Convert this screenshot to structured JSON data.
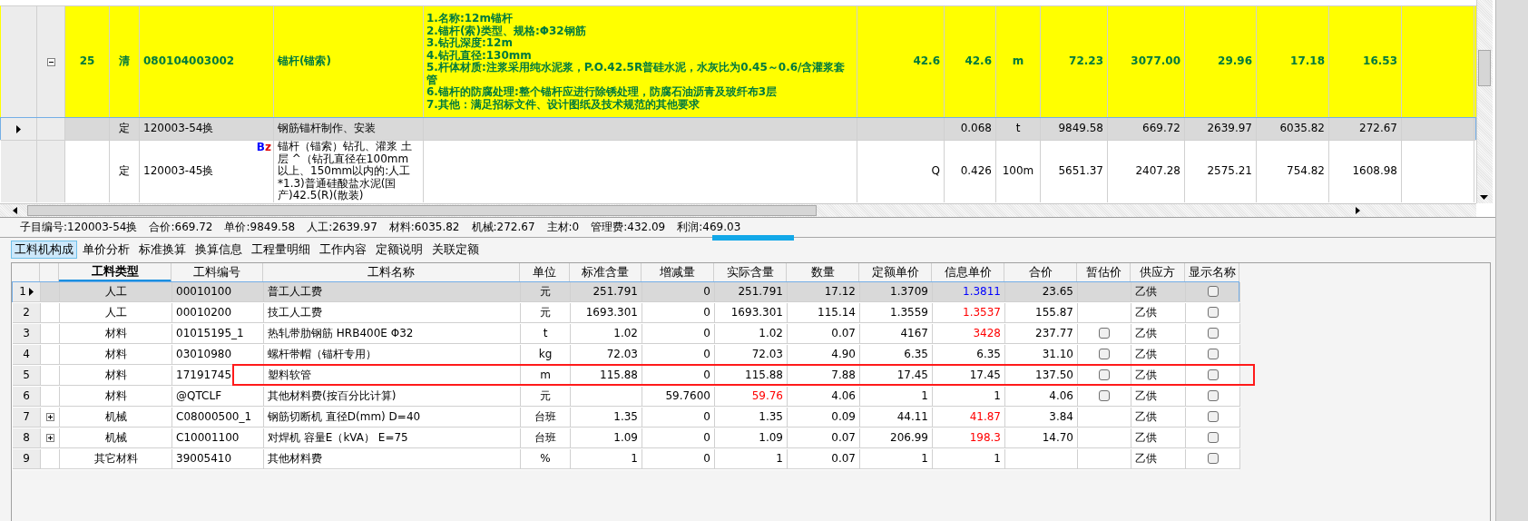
{
  "top_grid": {
    "rows": [
      {
        "kind": "bill",
        "selected": false,
        "expanded": true,
        "number": "25",
        "type": "清",
        "code": "080104003002",
        "name": "锚杆(锚索)",
        "description": [
          "1.名称:12m锚杆",
          "2.锚杆(索)类型、规格:Φ32钢筋",
          "3.钻孔深度:12m",
          "4.钻孔直径:130mm",
          "5.杆体材质:注浆采用纯水泥浆，P.O.42.5R普硅水泥，水灰比为0.45～0.6/含灌浆套管",
          "6.锚杆的防腐处理:整个锚杆应进行除锈处理，防腐石油沥青及玻纤布3层",
          "7.其他：满足招标文件、设计图纸及技术规范的其他要求"
        ],
        "column_8": "42.6",
        "column_9": "42.6",
        "column_10": "m",
        "column_11": "72.23",
        "column_12": "3077.00",
        "column_13": "29.96",
        "column_14": "17.18",
        "column_15": "16.53"
      },
      {
        "kind": "quota",
        "selected": true,
        "type": "定",
        "code": "120003-54换",
        "name": "钢筋锚杆制作、安装",
        "column_9": "0.068",
        "column_10": "t",
        "column_11": "9849.58",
        "column_12": "669.72",
        "column_13": "2639.97",
        "column_14": "6035.82",
        "column_15": "272.67"
      },
      {
        "kind": "quota",
        "selected": false,
        "type": "定",
        "code": "120003-45换",
        "badge": [
          {
            "text": "B",
            "color": "#0000ff"
          },
          {
            "text": "z",
            "color": "#e00000"
          }
        ],
        "name": "锚杆（锚索）钻孔、灌浆 土层 ^（钻孔直径在100mm以上、150mm以内的:人工*1.3)普通硅酸盐水泥(国产)42.5(R)(散装)",
        "column_8": "Q",
        "column_9": "0.426",
        "column_10": "100m",
        "column_11": "5651.37",
        "column_12": "2407.28",
        "column_13": "2575.21",
        "column_14": "754.82",
        "column_15": "1608.98"
      }
    ]
  },
  "summary": [
    "子目编号:120003-54换",
    "合价:669.72",
    "单价:9849.58",
    "人工:2639.97",
    "材料:6035.82",
    "机械:272.67",
    "主材:0",
    "管理费:432.09",
    "利润:469.03"
  ],
  "tabs": [
    {
      "label": "工料机构成",
      "selected": true
    },
    {
      "label": "单价分析",
      "selected": false
    },
    {
      "label": "标准换算",
      "selected": false
    },
    {
      "label": "换算信息",
      "selected": false
    },
    {
      "label": "工程量明细",
      "selected": false
    },
    {
      "label": "工作内容",
      "selected": false
    },
    {
      "label": "定额说明",
      "selected": false
    },
    {
      "label": "关联定额",
      "selected": false
    }
  ],
  "detail_grid": {
    "columns": [
      {
        "label": "工料类型",
        "sorted": true
      },
      {
        "label": "工料编号",
        "sorted": false
      },
      {
        "label": "工料名称",
        "sorted": false
      },
      {
        "label": "单位",
        "sorted": false
      },
      {
        "label": "标准含量",
        "sorted": false
      },
      {
        "label": "增减量",
        "sorted": false
      },
      {
        "label": "实际含量",
        "sorted": false
      },
      {
        "label": "数量",
        "sorted": false
      },
      {
        "label": "定额单价",
        "sorted": false
      },
      {
        "label": "信息单价",
        "sorted": false
      },
      {
        "label": "合价",
        "sorted": false
      },
      {
        "label": "暂估价",
        "sorted": false
      },
      {
        "label": "供应方",
        "sorted": false
      },
      {
        "label": "显示名称",
        "sorted": false
      }
    ],
    "rows": [
      {
        "number": "1",
        "selected": true,
        "outlined": false,
        "type": "人工",
        "code": "00010100",
        "name": "普工人工费",
        "unit": "元",
        "standard_qty": "251.791",
        "adjust_qty": "0",
        "actual_qty": "251.791",
        "quantity": "17.12",
        "quota_price": "1.3709",
        "info_price": {
          "text": "1.3811",
          "color": "#0000ff"
        },
        "total": "23.65",
        "supplier": "乙供",
        "show_name_checked": false
      },
      {
        "number": "2",
        "selected": false,
        "outlined": false,
        "type": "人工",
        "code": "00010200",
        "name": "技工人工费",
        "unit": "元",
        "standard_qty": "1693.301",
        "adjust_qty": "0",
        "actual_qty": "1693.301",
        "quantity": "115.14",
        "quota_price": "1.3559",
        "info_price": {
          "text": "1.3537",
          "color": "#ff0000"
        },
        "total": "155.87",
        "supplier": "乙供",
        "show_name_checked": false
      },
      {
        "number": "3",
        "selected": false,
        "outlined": false,
        "type": "材料",
        "code": "01015195_1",
        "name": "热轧带肋钢筋 HRB400E Φ32",
        "unit": "t",
        "standard_qty": "1.02",
        "adjust_qty": "0",
        "actual_qty": "1.02",
        "quantity": "0.07",
        "quota_price": "4167",
        "info_price": {
          "text": "3428",
          "color": "#ff0000"
        },
        "total": "237.77",
        "provisional_checked": false,
        "supplier": "乙供",
        "show_name_checked": false
      },
      {
        "number": "4",
        "selected": false,
        "outlined": false,
        "type": "材料",
        "code": "03010980",
        "name": "螺杆带帽（锚杆专用）",
        "unit": "kg",
        "standard_qty": "72.03",
        "adjust_qty": "0",
        "actual_qty": "72.03",
        "quantity": "4.90",
        "quota_price": "6.35",
        "info_price": "6.35",
        "total": "31.10",
        "provisional_checked": false,
        "supplier": "乙供",
        "show_name_checked": false
      },
      {
        "number": "5",
        "selected": false,
        "outlined": true,
        "type": "材料",
        "code": "17191745",
        "name": "塑料软管",
        "unit": "m",
        "standard_qty": "115.88",
        "adjust_qty": "0",
        "actual_qty": "115.88",
        "quantity": "7.88",
        "quota_price": "17.45",
        "info_price": "17.45",
        "total": "137.50",
        "provisional_checked": false,
        "supplier": "乙供",
        "show_name_checked": false
      },
      {
        "number": "6",
        "selected": false,
        "outlined": false,
        "type": "材料",
        "code": "@QTCLF",
        "name": "其他材料费(按百分比计算)",
        "unit": "元",
        "adjust_qty": "59.7600",
        "actual_qty": {
          "text": "59.76",
          "color": "#ff0000"
        },
        "quantity": "4.06",
        "quota_price": "1",
        "info_price": "1",
        "total": "4.06",
        "provisional_checked": false,
        "supplier": "乙供",
        "show_name_checked": false
      },
      {
        "number": "7",
        "selected": false,
        "outlined": false,
        "expanded": false,
        "type": "机械",
        "code": "C08000500_1",
        "name": "钢筋切断机 直径D(mm) D=40",
        "unit": "台班",
        "standard_qty": "1.35",
        "adjust_qty": "0",
        "actual_qty": "1.35",
        "quantity": "0.09",
        "quota_price": "44.11",
        "info_price": {
          "text": "41.87",
          "color": "#ff0000"
        },
        "total": "3.84",
        "supplier": "乙供",
        "show_name_checked": false
      },
      {
        "number": "8",
        "selected": false,
        "outlined": false,
        "expanded": false,
        "type": "机械",
        "code": "C10001100",
        "name": "对焊机 容量E（kVA） E=75",
        "unit": "台班",
        "standard_qty": "1.09",
        "adjust_qty": "0",
        "actual_qty": "1.09",
        "quantity": "0.07",
        "quota_price": "206.99",
        "info_price": {
          "text": "198.3",
          "color": "#ff0000"
        },
        "total": "14.70",
        "supplier": "乙供",
        "show_name_checked": false
      },
      {
        "number": "9",
        "selected": false,
        "outlined": false,
        "type": "其它材料",
        "code": "39005410",
        "name": "其他材料费",
        "unit": "%",
        "standard_qty": "1",
        "adjust_qty": "0",
        "actual_qty": "1",
        "quantity": "0.07",
        "quota_price": "1",
        "info_price": "1",
        "supplier": "乙供",
        "show_name_checked": false
      }
    ]
  }
}
